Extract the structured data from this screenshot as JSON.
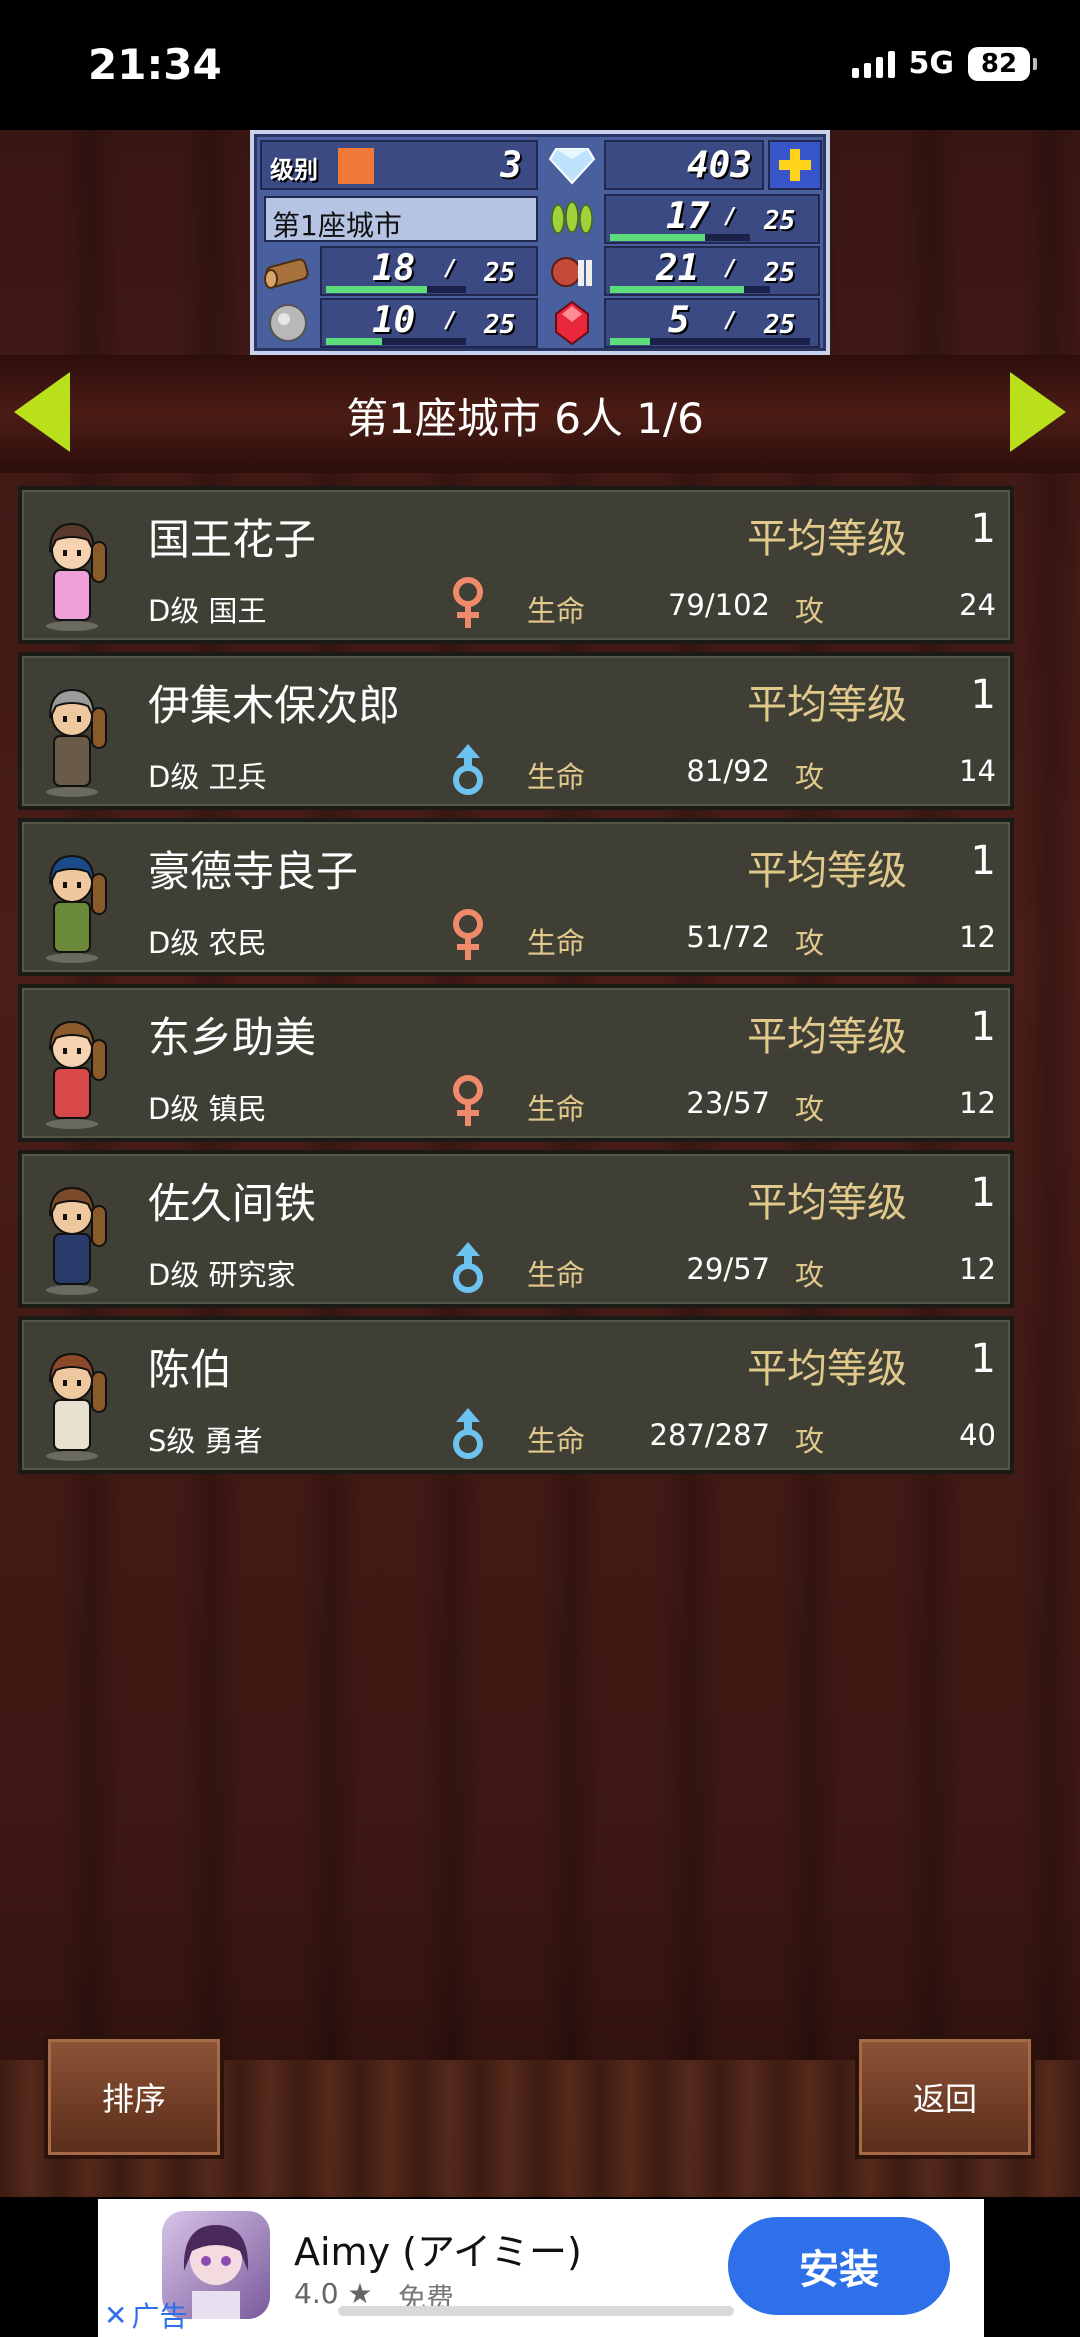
{
  "status_bar": {
    "time": "21:34",
    "network": "5G",
    "battery": "82"
  },
  "resources": {
    "level_label": "级别",
    "level": "3",
    "gems": "403",
    "city_name": "第1座城市",
    "food": {
      "value": "17",
      "max": "25",
      "fill": 0.68
    },
    "wood": {
      "value": "18",
      "max": "25",
      "fill": 0.72
    },
    "meat": {
      "value": "21",
      "max": "25",
      "fill": 0.84
    },
    "stone": {
      "value": "10",
      "max": "25",
      "fill": 0.4
    },
    "ruby": {
      "value": "5",
      "max": "25",
      "fill": 0.2
    },
    "sep": "/"
  },
  "header": {
    "title": "第1座城市  6人 1/6"
  },
  "labels": {
    "avg_level": "平均等级",
    "hp": "生命",
    "atk": "攻"
  },
  "characters": [
    {
      "name": "国王花子",
      "avg_level": "1",
      "rank": "D级 国王",
      "gender": "female",
      "hp": "79/102",
      "atk": "24"
    },
    {
      "name": "伊集木保次郎",
      "avg_level": "1",
      "rank": "D级 卫兵",
      "gender": "male",
      "hp": "81/92",
      "atk": "14"
    },
    {
      "name": "豪德寺良子",
      "avg_level": "1",
      "rank": "D级 农民",
      "gender": "female",
      "hp": "51/72",
      "atk": "12"
    },
    {
      "name": "东乡助美",
      "avg_level": "1",
      "rank": "D级 镇民",
      "gender": "female",
      "hp": "23/57",
      "atk": "12"
    },
    {
      "name": "佐久间铁",
      "avg_level": "1",
      "rank": "D级 研究家",
      "gender": "male",
      "hp": "29/57",
      "atk": "12"
    },
    {
      "name": "陈伯",
      "avg_level": "1",
      "rank": "S级 勇者",
      "gender": "male",
      "hp": "287/287",
      "atk": "40"
    }
  ],
  "buttons": {
    "sort": "排序",
    "back": "返回"
  },
  "ad": {
    "app_name": "Aimy (アイミー)",
    "rating": "4.0 ★",
    "price": "免费",
    "install": "安装",
    "close_label": "广告"
  },
  "colors": {
    "female": "#f08a6a",
    "male": "#6cc3f0",
    "accent_text": "#e1c98c",
    "arrow": "#b9e01a"
  }
}
